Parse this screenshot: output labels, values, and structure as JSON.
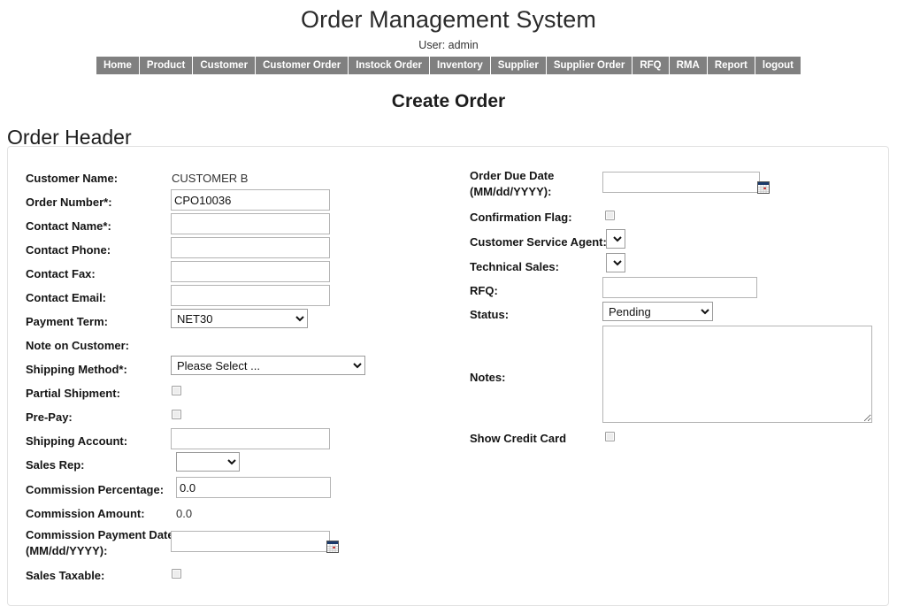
{
  "app": {
    "title": "Order Management System",
    "user_line": "User: admin"
  },
  "nav": {
    "items": [
      {
        "label": "Home"
      },
      {
        "label": "Product"
      },
      {
        "label": "Customer"
      },
      {
        "label": "Customer Order"
      },
      {
        "label": "Instock Order"
      },
      {
        "label": "Inventory"
      },
      {
        "label": "Supplier"
      },
      {
        "label": "Supplier Order"
      },
      {
        "label": "RFQ"
      },
      {
        "label": "RMA"
      },
      {
        "label": "Report"
      },
      {
        "label": "logout"
      }
    ]
  },
  "page": {
    "title": "Create Order",
    "section_title": "Order Header"
  },
  "left": {
    "customer_name_label": "Customer Name:",
    "customer_name_value": "CUSTOMER B",
    "order_number_label": "Order Number*:",
    "order_number_value": "CPO10036",
    "contact_name_label": "Contact Name*:",
    "contact_name_value": "",
    "contact_phone_label": "Contact Phone:",
    "contact_phone_value": "",
    "contact_fax_label": "Contact Fax:",
    "contact_fax_value": "",
    "contact_email_label": "Contact Email:",
    "contact_email_value": "",
    "payment_term_label": "Payment Term:",
    "payment_term_value": "NET30",
    "payment_term_options": [
      "NET30"
    ],
    "note_on_customer_label": "Note on Customer:",
    "shipping_method_label": "Shipping Method*:",
    "shipping_method_value": "Please Select ...",
    "shipping_method_options": [
      "Please Select ..."
    ],
    "partial_shipment_label": "Partial Shipment:",
    "partial_shipment_checked": false,
    "pre_pay_label": "Pre-Pay:",
    "pre_pay_checked": false,
    "shipping_account_label": "Shipping Account:",
    "shipping_account_value": "",
    "sales_rep_label": "Sales Rep:",
    "sales_rep_value": "",
    "sales_rep_options": [
      ""
    ],
    "commission_percentage_label": "Commission Percentage:",
    "commission_percentage_value": "0.0",
    "commission_amount_label": "Commission Amount:",
    "commission_amount_value": "0.0",
    "commission_payment_date_label_1": "Commission Payment Date",
    "commission_payment_date_label_2": "(MM/dd/YYYY):",
    "commission_payment_date_value": "",
    "commission_payment_date_icon": "calendar-icon",
    "sales_taxable_label": "Sales Taxable:",
    "sales_taxable_checked": false
  },
  "right": {
    "order_due_date_label_1": "Order Due Date",
    "order_due_date_label_2": "(MM/dd/YYYY):",
    "order_due_date_value": "",
    "order_due_date_icon": "calendar-icon",
    "confirmation_flag_label": "Confirmation Flag:",
    "confirmation_flag_checked": false,
    "customer_service_agent_label": "Customer Service Agent:",
    "customer_service_agent_value": "",
    "customer_service_agent_options": [
      ""
    ],
    "technical_sales_label": "Technical Sales:",
    "technical_sales_value": "",
    "technical_sales_options": [
      ""
    ],
    "rfq_label": "RFQ:",
    "rfq_value": "",
    "status_label": "Status:",
    "status_value": "Pending",
    "status_options": [
      "Pending"
    ],
    "notes_label": "Notes:",
    "notes_value": "",
    "show_credit_card_label": "Show Credit Card",
    "show_credit_card_checked": false
  },
  "colors": {
    "nav_background": "#808080",
    "nav_text": "#ffffff",
    "panel_border": "#e2e2e2",
    "label_text": "#151515",
    "input_border": "#b4b4b4",
    "calendar_accent": "#cc2222",
    "calendar_header": "#1b3a6b"
  }
}
